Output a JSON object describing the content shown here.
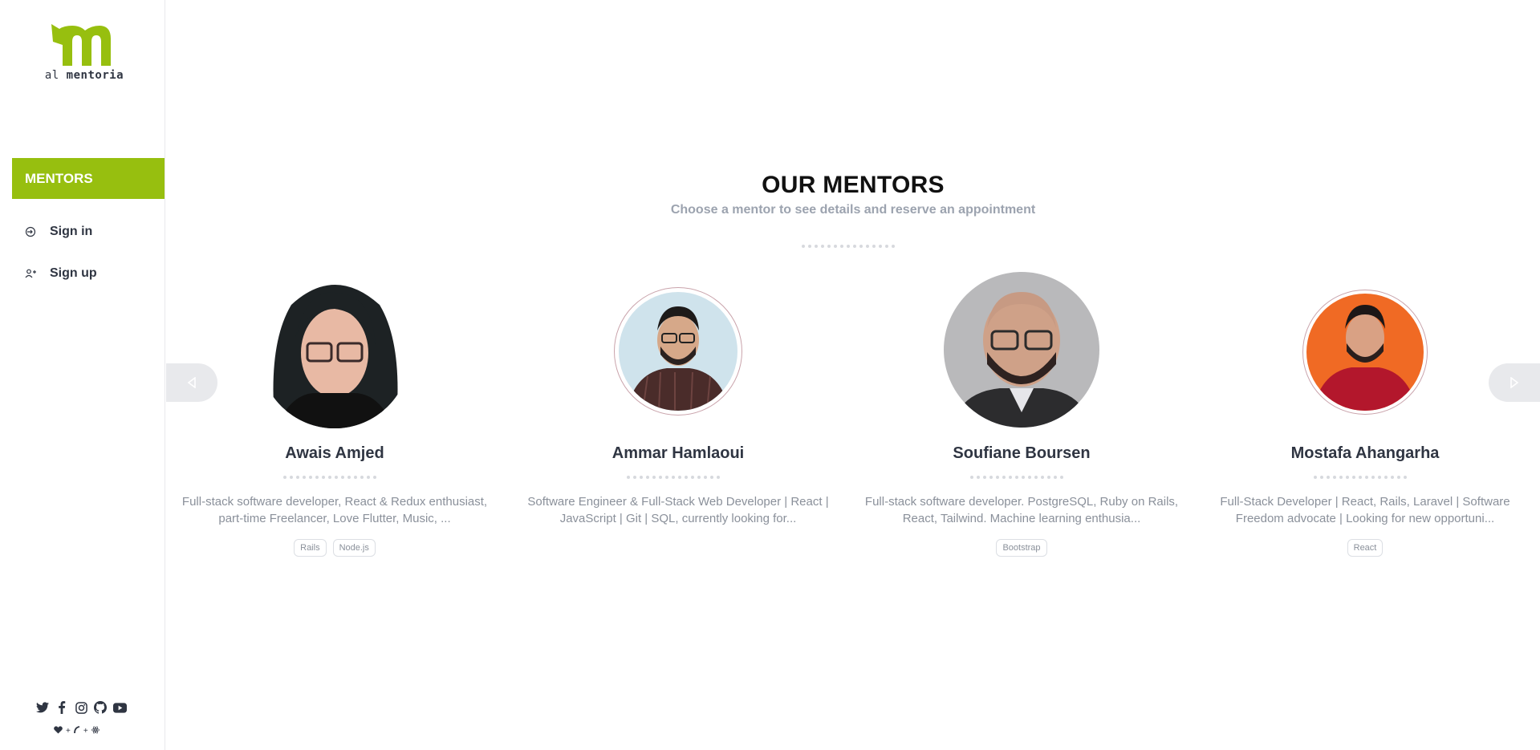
{
  "brand": {
    "logo_prefix": "al",
    "logo_name": "mentoria",
    "logo_color": "#97bf0f"
  },
  "sidebar": {
    "active_label": "MENTORS",
    "items": [
      {
        "label": "Sign in",
        "icon": "sign-in-icon"
      },
      {
        "label": "Sign up",
        "icon": "user-plus-icon"
      }
    ],
    "social_icons": [
      "twitter-icon",
      "facebook-icon",
      "instagram-icon",
      "github-icon",
      "youtube-icon"
    ],
    "credit_icons": [
      "heart-icon",
      "plus-icon",
      "rails-icon",
      "plus-icon",
      "react-icon"
    ]
  },
  "main": {
    "title": "OUR MENTORS",
    "subtitle": "Choose a mentor to see details and reserve an appointment"
  },
  "mentors": [
    {
      "name": "Awais Amjed",
      "bio": "Full-stack software developer, React & Redux enthusiast, part-time Freelancer, Love Flutter, Music, ...",
      "tags": [
        "Rails",
        "Node.js"
      ]
    },
    {
      "name": "Ammar Hamlaoui",
      "bio": "Software Engineer & Full-Stack Web Developer | React | JavaScript | Git | SQL, currently looking for...",
      "tags": []
    },
    {
      "name": "Soufiane Boursen",
      "bio": "Full-stack software developer. PostgreSQL, Ruby on Rails, React, Tailwind. Machine learning enthusia...",
      "tags": [
        "Bootstrap"
      ]
    },
    {
      "name": "Mostafa Ahangarha",
      "bio": "Full-Stack Developer | React, Rails, Laravel | Software Freedom advocate | Looking for new opportuni...",
      "tags": [
        "React"
      ]
    }
  ],
  "colors": {
    "accent": "#97bf0f",
    "text": "#2f3542",
    "muted": "#9ca3af",
    "arrow_bg": "#e8e9ec"
  }
}
